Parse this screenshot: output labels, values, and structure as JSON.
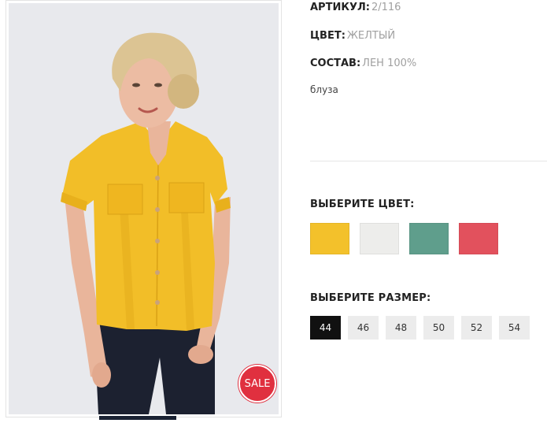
{
  "product": {
    "sale_label": "SALE",
    "article_label": "АРТИКУЛ:",
    "article_value": "2/116",
    "color_label": "ЦВЕТ:",
    "color_value": "ЖЕЛТЫЙ",
    "composition_label": "СОСТАВ:",
    "composition_value": "ЛЕН 100%",
    "description": "блуза"
  },
  "color_picker": {
    "title": "ВЫБЕРИТЕ ЦВЕТ:",
    "options": [
      {
        "name": "yellow",
        "hex": "#f3c12b"
      },
      {
        "name": "white",
        "hex": "#ededeb"
      },
      {
        "name": "teal",
        "hex": "#5f9e8c"
      },
      {
        "name": "red",
        "hex": "#e2515d"
      }
    ]
  },
  "size_picker": {
    "title": "ВЫБЕРИТЕ РАЗМЕР:",
    "selected": "44",
    "options": [
      "44",
      "46",
      "48",
      "50",
      "52",
      "54"
    ]
  },
  "colors": {
    "sale_badge": "#e0303f",
    "selected_size_bg": "#111111",
    "size_bg": "#ececec"
  }
}
